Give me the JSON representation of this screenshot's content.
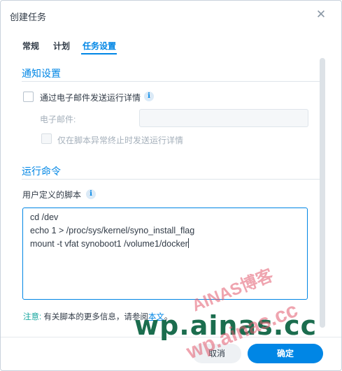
{
  "dialog": {
    "title": "创建任务",
    "close_icon": "close-icon"
  },
  "tabs": [
    {
      "label": "常规",
      "active": false
    },
    {
      "label": "计划",
      "active": false
    },
    {
      "label": "任务设置",
      "active": true
    }
  ],
  "notification": {
    "section_title": "通知设置",
    "email_checkbox_label": "通过电子邮件发送运行详情",
    "email_checked": false,
    "email_field_label": "电子邮件:",
    "email_value": "",
    "abnormal_checkbox_label": "仅在脚本异常终止时发送运行详情",
    "abnormal_checked": false
  },
  "run_command": {
    "section_title": "运行命令",
    "script_label": "用户定义的脚本",
    "script_lines": [
      "cd /dev",
      "echo 1 > /proc/sys/kernel/syno_install_flag",
      "mount -t vfat synoboot1 /volume1/docker"
    ]
  },
  "note": {
    "head": "注意:",
    "text": " 有关脚本的更多信息，请参阅",
    "link": "本文",
    "tail": "。"
  },
  "footer": {
    "cancel_label": "取消",
    "ok_label": "确定"
  },
  "watermarks": {
    "main": "wp.ainas.cc",
    "red1": "AINAS博客",
    "red2": "wp.ainas.cc"
  },
  "colors": {
    "accent": "#0086e5",
    "note_head": "#1aa7a0",
    "watermark_green": "#1b6d4e"
  }
}
